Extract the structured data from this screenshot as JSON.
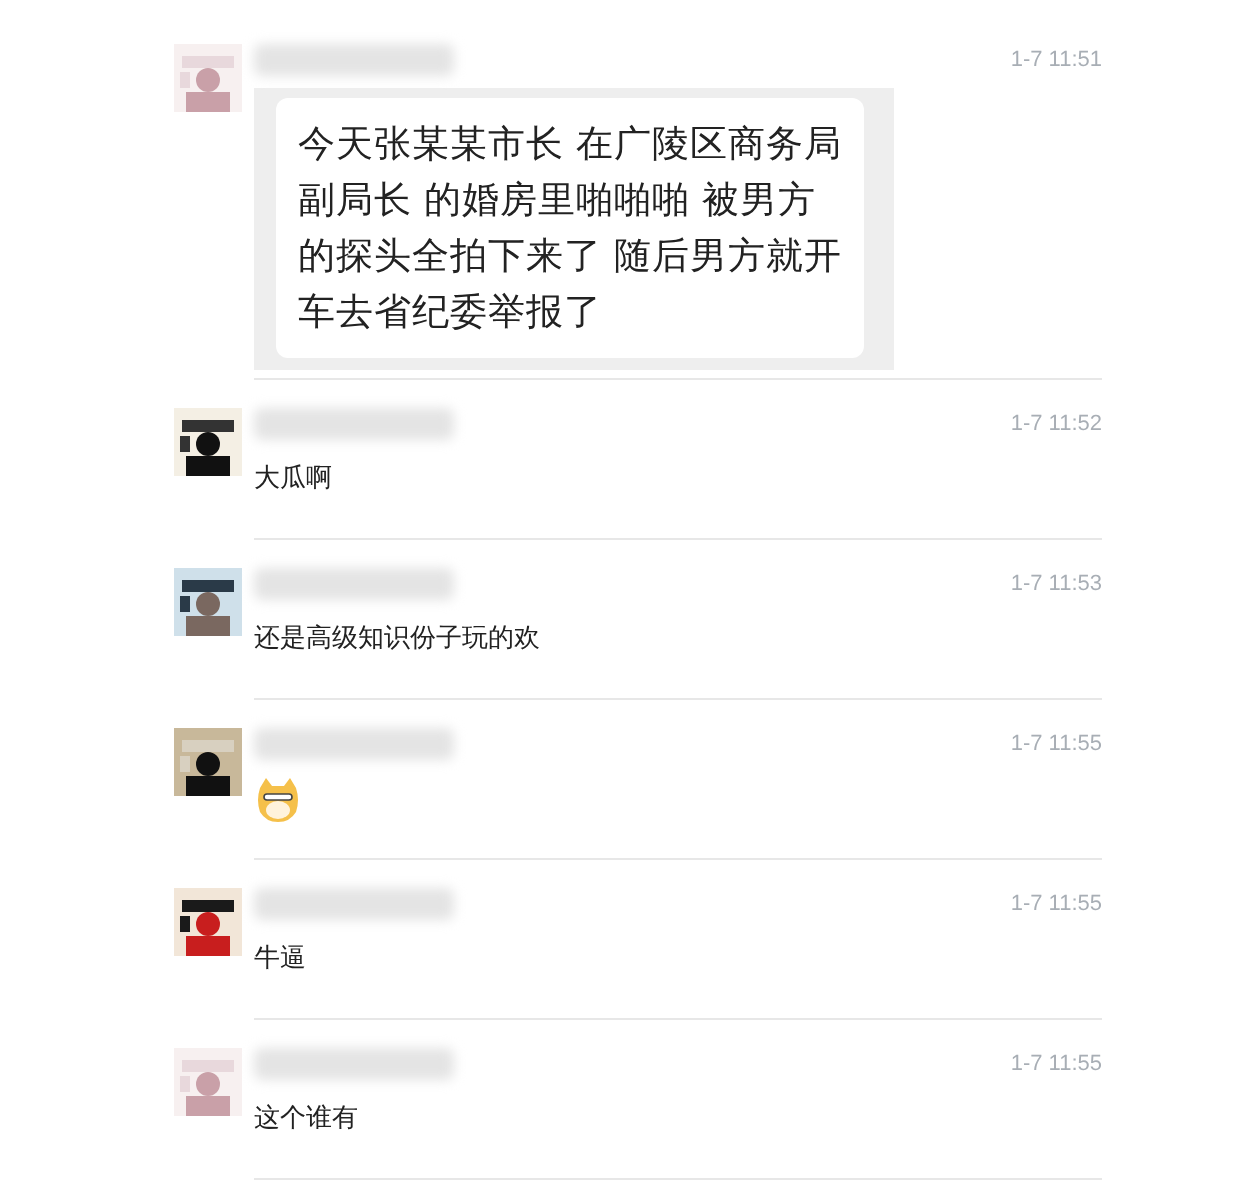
{
  "messages": [
    {
      "time": "1-7 11:51",
      "lines": [
        "今天张某某市长  在广陵区商务局副局长 的婚房里啪啪啪 被男方的探头全拍下来了 随后男方就开车去省纪委举报了"
      ]
    },
    {
      "time": "1-7 11:52",
      "kind": "text",
      "text": "大瓜啊"
    },
    {
      "time": "1-7 11:53",
      "kind": "text",
      "text": "还是高级知识份子玩的欢"
    },
    {
      "time": "1-7 11:55",
      "kind": "sticker"
    },
    {
      "time": "1-7 11:55",
      "kind": "text",
      "text": "牛逼"
    },
    {
      "time": "1-7 11:55",
      "kind": "text",
      "text": "这个谁有"
    }
  ]
}
